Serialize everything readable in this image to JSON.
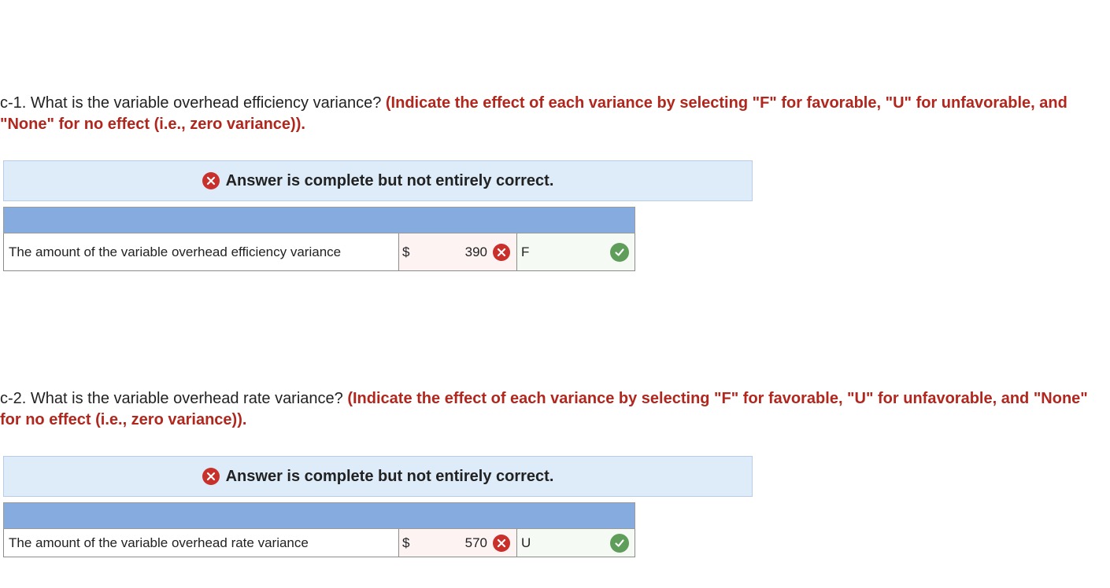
{
  "questions": [
    {
      "prompt": "c-1. What is the variable overhead efficiency variance? ",
      "instruction": "(Indicate the effect of each variance by selecting \"F\" for favorable, \"U\" for unfavorable, and \"None\" for no effect (i.e., zero variance)).",
      "banner": "Answer is complete but not entirely correct.",
      "row": {
        "label": "The amount of the variable overhead efficiency variance",
        "currency": "$",
        "amount": "390",
        "effect": "F"
      }
    },
    {
      "prompt": "c-2. What is the variable overhead rate variance? ",
      "instruction": "(Indicate the effect of each variance by selecting \"F\" for favorable, \"U\" for unfavorable, and \"None\" for no effect (i.e., zero variance)).",
      "banner": "Answer is complete but not entirely correct.",
      "row": {
        "label": "The amount of the variable overhead rate variance",
        "currency": "$",
        "amount": "570",
        "effect": "U"
      }
    }
  ],
  "colors": {
    "instruction": "#b1271e",
    "banner_bg": "#deebf8",
    "header_bg": "#85abdf",
    "incorrect_icon": "#c9302c",
    "correct_icon": "#5e9e5a"
  },
  "icons": {
    "incorrect": "x-circle-icon",
    "correct": "check-circle-icon"
  }
}
